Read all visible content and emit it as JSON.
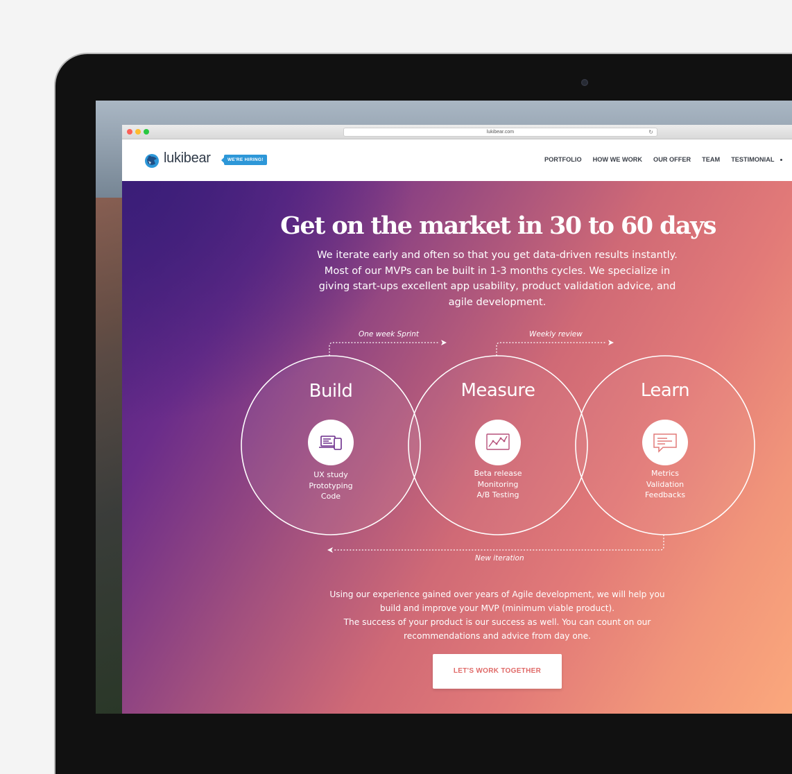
{
  "browser": {
    "url": "lukibear.com"
  },
  "header": {
    "logo_text": "lukibear",
    "hiring_badge": "WE'RE HIRING!",
    "nav": [
      "PORTFOLIO",
      "HOW WE WORK",
      "OUR OFFER",
      "TEAM",
      "TESTIMONIAL"
    ]
  },
  "hero": {
    "headline": "Get on the market in 30 to 60 days",
    "intro": "We iterate early and often so that you get data-driven results instantly. Most of our MVPs can be built in 1-3 months cycles. We specialize in giving start-ups excellent app usability, product validation advice, and agile development.",
    "cycle": [
      {
        "title": "Build",
        "items": [
          "UX study",
          "Prototyping",
          "Code"
        ],
        "icon": "devices-icon"
      },
      {
        "title": "Measure",
        "items": [
          "Beta release",
          "Monitoring",
          "A/B Testing"
        ],
        "icon": "chart-icon"
      },
      {
        "title": "Learn",
        "items": [
          "Metrics",
          "Validation",
          "Feedbacks"
        ],
        "icon": "chat-icon"
      }
    ],
    "arrows": {
      "sprint": "One week Sprint",
      "review": "Weekly review",
      "iteration": "New iteration"
    },
    "outro_1": "Using our experience gained over years of Agile development, we will help you build and improve your MVP (minimum viable product).",
    "outro_2": "The success of your product is our success as well. You can count on our recommendations and advice from day one.",
    "cta_label": "LET'S WORK TOGETHER"
  },
  "colors": {
    "accent_blue": "#2d97d8",
    "gradient_start": "#4a2080",
    "gradient_end": "#fba87c",
    "cta_text": "#e06a68"
  }
}
